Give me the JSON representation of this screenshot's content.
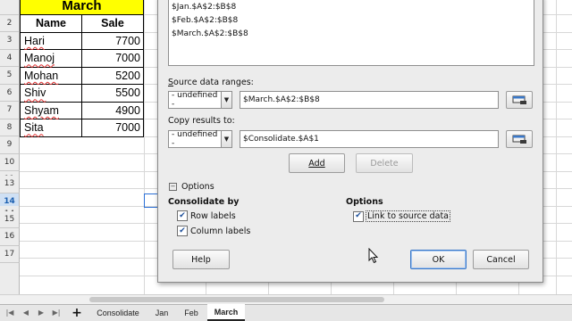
{
  "sheet": {
    "header": {
      "title": "March",
      "col_name": "Name",
      "col_sale": "Sale"
    },
    "row_numbers": [
      "2",
      "3",
      "4",
      "5",
      "6",
      "7",
      "8",
      "9",
      "10",
      "11",
      "12",
      "13",
      "14",
      "15",
      "16",
      "17"
    ],
    "active_row": "14",
    "rows": [
      {
        "name": "Hari",
        "sale": "7700"
      },
      {
        "name": "Manoj",
        "sale": "7000"
      },
      {
        "name": "Mohan",
        "sale": "5200"
      },
      {
        "name": "Shiv",
        "sale": "5500"
      },
      {
        "name": "Shyam",
        "sale": "4900"
      },
      {
        "name": "Sita",
        "sale": "7000"
      }
    ]
  },
  "dialog": {
    "ranges": [
      "$Jan.$A$2:$B$8",
      "$Feb.$A$2:$B$8",
      "$March.$A$2:$B$8"
    ],
    "source_label": "Source data ranges:",
    "source_combo": "- undefined -",
    "source_value": "$March.$A$2:$B$8",
    "copy_label": "Copy results to:",
    "copy_combo": "- undefined -",
    "copy_value": "$Consolidate.$A$1",
    "add_button": "Add",
    "delete_button": "Delete",
    "options_toggle": "Options",
    "consolidate_by": "Consolidate by",
    "row_labels": "Row labels",
    "column_labels": "Column labels",
    "options_heading": "Options",
    "link_to_source": "Link to source data",
    "help_button": "Help",
    "ok_button": "OK",
    "cancel_button": "Cancel"
  },
  "tabs": {
    "add_symbol": "+",
    "items": [
      "Consolidate",
      "Jan",
      "Feb",
      "March"
    ],
    "active": "March"
  },
  "colors": {
    "header_yellow": "#ffff00",
    "accent_blue": "#3a78c8",
    "active_row": "#cfe0f4"
  }
}
